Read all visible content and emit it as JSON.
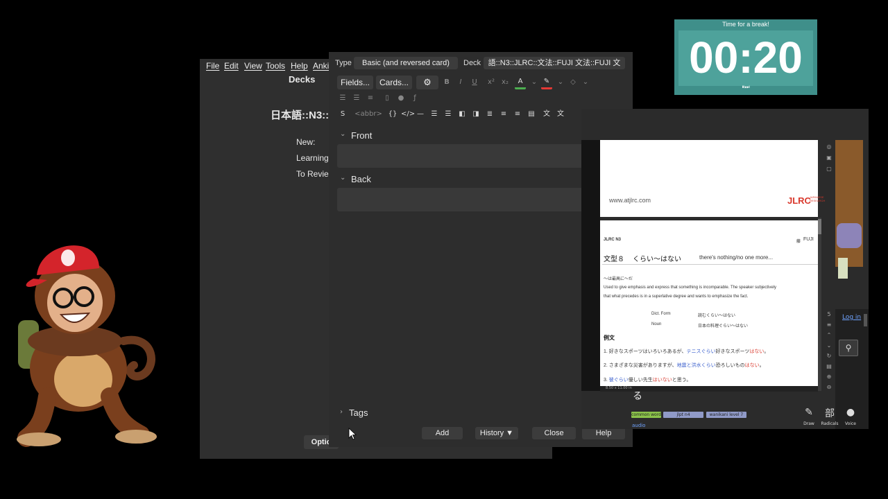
{
  "anki_main": {
    "menu": [
      "File",
      "Edit",
      "View",
      "Tools",
      "Help",
      "Anki"
    ],
    "decks_heading": "Decks",
    "deck_title": "日本語::N3::",
    "stats": {
      "new": "New:",
      "learning": "Learning",
      "to_review": "To Revie"
    },
    "options_label": "Optio"
  },
  "add_dialog": {
    "type_label": "Type",
    "type_value": "Basic (and reversed card)",
    "deck_label": "Deck",
    "deck_value": "語::N3::JLRC::文法::FUJI 文法::FUJI 文",
    "fields_btn": "Fields...",
    "cards_btn": "Cards...",
    "abbr_tool": "<abbr>",
    "front_label": "Front",
    "back_label": "Back",
    "tags_label": "Tags",
    "buttons": {
      "add": "Add",
      "history": "History ▼",
      "close": "Close",
      "help": "Help"
    }
  },
  "timer": {
    "caption": "Time for a break!",
    "time": "00:20",
    "controls": "⏸⏭"
  },
  "viewer": {
    "site": "www.atjlrc.com",
    "logo": "JLRC",
    "logo_small": "JAPANESE RESEARCH",
    "header_left": "JLRC N3",
    "header_right": "FUJI",
    "header_mark": "藤",
    "pattern_no": "文型８",
    "pattern": "くらい〜はない",
    "pattern_en": "there's nothing/no one more...",
    "sub_jp": "〜は最高に〜だ",
    "desc1": "Used to give emphasis and express that something is incomparable. The speaker subjectively",
    "desc2": "that what precedes is in a superlative degree and wants to emphasize the fact.",
    "form1_label": "Dict. Form",
    "form1_value": "読むくらい〜はない",
    "form2_label": "Noun",
    "form2_value": "日本の料理ぐらい〜はない",
    "examples_heading": "例文",
    "ex1_a": "1. 好きなスポーツはいろいろあるが、",
    "ex1_b": "テニスぐらい",
    "ex1_c": "好きなスポーツ",
    "ex1_d": "はない",
    "ex1_e": "。",
    "ex2_a": "2. さまざまな災害がありますが、",
    "ex2_b": "地震と洪水くらい",
    "ex2_c": "恐ろしいもの",
    "ex2_d": "はない",
    "ex2_e": "。",
    "ex3_a": "3. ",
    "ex3_b": "彼ぐらい",
    "ex3_c": "優しい先生",
    "ex3_d": "はいない",
    "ex3_e": "と思う。",
    "zoom_text": "8.50 x 11.00 in",
    "kana": "る",
    "login": "Log in",
    "tags": [
      "common word",
      "jlpt n4",
      "wanikani level 7"
    ],
    "audio": "audio",
    "right_tools": {
      "draw": "Draw",
      "radicals": "Radicals",
      "radicals_glyph": "部",
      "voice": "Voice"
    }
  },
  "colors": {
    "timer_bg": "#3f8f8a",
    "red": "#d9382c",
    "blue": "#3a5fcd"
  }
}
